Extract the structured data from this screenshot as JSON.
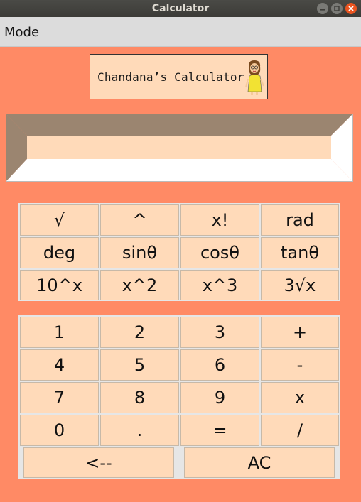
{
  "window": {
    "title": "Calculator"
  },
  "menu": {
    "mode": "Mode"
  },
  "logo": {
    "text": "Chandana’s Calculator"
  },
  "display": {
    "value": ""
  },
  "scientific_keys": [
    [
      "√",
      "^",
      "x!",
      "rad"
    ],
    [
      "deg",
      "sinθ",
      "cosθ",
      "tanθ"
    ],
    [
      "10^x",
      "x^2",
      "x^3",
      "3√x"
    ]
  ],
  "number_keys": [
    [
      "1",
      "2",
      "3",
      "+"
    ],
    [
      "4",
      "5",
      "6",
      "-"
    ],
    [
      "7",
      "8",
      "9",
      "x"
    ],
    [
      "0",
      ".",
      "=",
      "/"
    ]
  ],
  "bottom_keys": {
    "backspace": "<--",
    "clear": "AC"
  },
  "colors": {
    "background": "#ff8a65",
    "key": "#ffdab9",
    "titlebar": "#3c3b37",
    "close": "#e95420"
  }
}
